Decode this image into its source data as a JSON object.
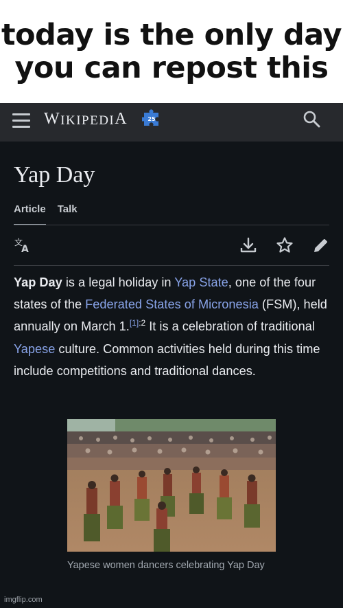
{
  "meme": {
    "line1": "today is the only day",
    "line2": "you can repost this"
  },
  "header": {
    "wordmark_w": "W",
    "wordmark_rest": "IKIPEDI",
    "wordmark_a": "A",
    "icons": [
      "hamburger-menu-icon",
      "wikipedia-25-puzzle-icon",
      "search-icon"
    ]
  },
  "article": {
    "title": "Yap Day",
    "tabs": [
      {
        "label": "Article",
        "active": true
      },
      {
        "label": "Talk",
        "active": false
      }
    ],
    "actions": [
      "language-icon",
      "download-icon",
      "star-icon",
      "edit-pencil-icon"
    ],
    "paragraph": {
      "bold": "Yap Day",
      "t1": " is a legal holiday in ",
      "link1": "Yap State",
      "t2": ", one of the four states of the ",
      "link2": "Federated States of Micronesia",
      "t3": " (FSM), held annually on March 1.",
      "ref_link": "[1]",
      "ref_page": ":2",
      "t4": " It is a celebration of traditional ",
      "link3": "Yapese",
      "t5": " culture. Common activities held during this time include competitions and traditional dances."
    },
    "figure": {
      "caption": "Yapese women dancers celebrating Yap Day"
    }
  },
  "watermark": "imgflip.com",
  "colors": {
    "background": "#101418",
    "header": "#27292d",
    "text": "#eaecf0",
    "link": "#88a3e8",
    "muted": "#a2a9b1"
  }
}
